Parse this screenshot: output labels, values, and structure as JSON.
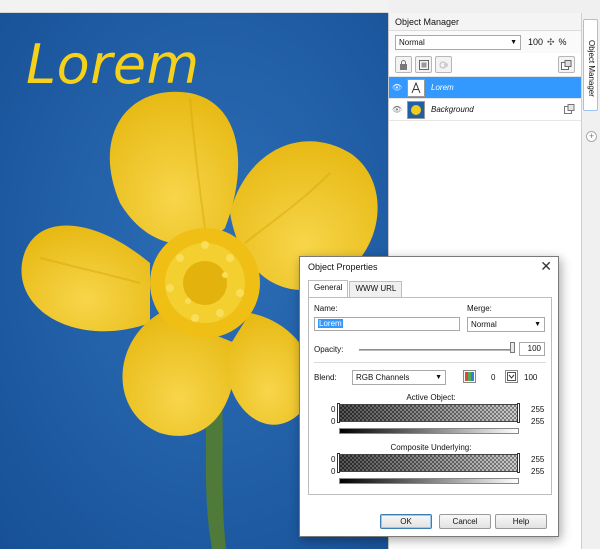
{
  "canvas": {
    "text": "Lorem"
  },
  "object_manager": {
    "title": "Object Manager",
    "blend_mode": "Normal",
    "opacity": "100",
    "opacity_unit": "%",
    "layers": [
      {
        "name": "Lorem",
        "selected": true
      },
      {
        "name": "Background",
        "selected": false
      }
    ],
    "side_tab": "Object Manager"
  },
  "dialog": {
    "title": "Object Properties",
    "tabs": [
      "General",
      "WWW URL"
    ],
    "name_label": "Name:",
    "name_value": "Lorem",
    "merge_label": "Merge:",
    "merge_value": "Normal",
    "opacity_label": "Opacity:",
    "opacity_value": "100",
    "opacity_level": 1.0,
    "blend_label": "Blend:",
    "blend_value": "RGB Channels",
    "blend_left": "0",
    "blend_right": "100",
    "active_object_label": "Active Object:",
    "active_ranges": [
      {
        "min": "0",
        "max": "255"
      },
      {
        "min": "0",
        "max": "255"
      }
    ],
    "composite_label": "Composite Underlying:",
    "composite_ranges": [
      {
        "min": "0",
        "max": "255"
      },
      {
        "min": "0",
        "max": "255"
      }
    ],
    "ok": "OK",
    "cancel": "Cancel",
    "help": "Help"
  },
  "colors": {
    "selection": "#3399ff",
    "sky": "#1f5fa8",
    "petal": "#f2cc1c",
    "lorem_text": "#f5d11c"
  }
}
